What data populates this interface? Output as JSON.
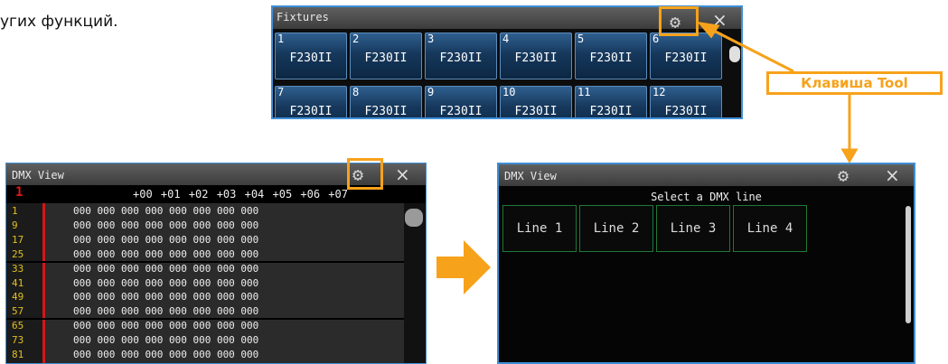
{
  "intro_text": "угих функций.",
  "fixtures": {
    "title": "Fixtures",
    "buttons": [
      {
        "num": "1",
        "label": "F230II"
      },
      {
        "num": "2",
        "label": "F230II"
      },
      {
        "num": "3",
        "label": "F230II"
      },
      {
        "num": "4",
        "label": "F230II"
      },
      {
        "num": "5",
        "label": "F230II"
      },
      {
        "num": "6",
        "label": "F230II"
      },
      {
        "num": "7",
        "label": "F230II"
      },
      {
        "num": "8",
        "label": "F230II"
      },
      {
        "num": "9",
        "label": "F230II"
      },
      {
        "num": "10",
        "label": "F230II"
      },
      {
        "num": "11",
        "label": "F230II"
      },
      {
        "num": "12",
        "label": "F230II"
      }
    ],
    "gear_icon": "gear-icon",
    "close_label": "×"
  },
  "callout": {
    "label": "Клавиша Tool",
    "color": "#f7a21b"
  },
  "dmx_left": {
    "title": "DMX View",
    "line_number": "1",
    "offsets": "+00 +01 +02 +03 +04 +05 +06 +07",
    "rows": [
      {
        "addr": "1",
        "values": "000 000 000 000 000 000 000 000"
      },
      {
        "addr": "9",
        "values": "000 000 000 000 000 000 000 000"
      },
      {
        "addr": "17",
        "values": "000 000 000 000 000 000 000 000"
      },
      {
        "addr": "25",
        "values": "000 000 000 000 000 000 000 000"
      },
      {
        "addr": "33",
        "values": "000 000 000 000 000 000 000 000"
      },
      {
        "addr": "41",
        "values": "000 000 000 000 000 000 000 000"
      },
      {
        "addr": "49",
        "values": "000 000 000 000 000 000 000 000"
      },
      {
        "addr": "57",
        "values": "000 000 000 000 000 000 000 000"
      },
      {
        "addr": "65",
        "values": "000 000 000 000 000 000 000 000"
      },
      {
        "addr": "73",
        "values": "000 000 000 000 000 000 000 000"
      },
      {
        "addr": "81",
        "values": "000 000 000 000 000 000 000 000"
      }
    ],
    "close_label": "×"
  },
  "dmx_right": {
    "title": "DMX View",
    "prompt": "Select a DMX line",
    "lines": [
      "Line 1",
      "Line 2",
      "Line 3",
      "Line 4"
    ],
    "close_label": "×"
  }
}
